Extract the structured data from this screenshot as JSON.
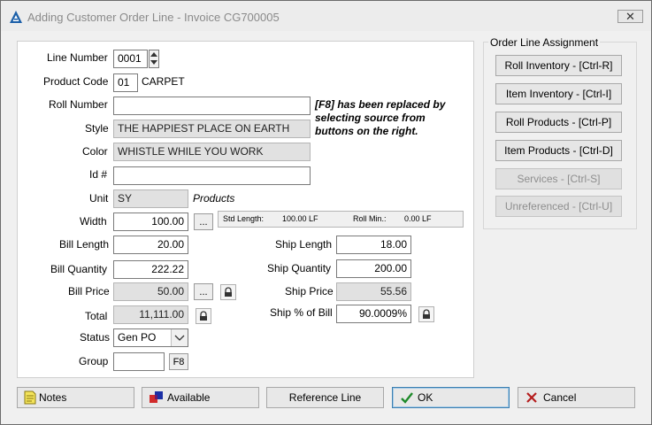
{
  "window": {
    "title": "Adding Customer Order Line - Invoice CG700005",
    "close_glyph": "✕"
  },
  "form": {
    "line_number": {
      "label": "Line Number",
      "value": "0001"
    },
    "product_code": {
      "label": "Product Code",
      "value": "01",
      "description": "CARPET"
    },
    "roll_number": {
      "label": "Roll Number",
      "value": ""
    },
    "note": "[F8] has been replaced by selecting source from buttons on the right.",
    "style": {
      "label": "Style",
      "value": "THE HAPPIEST PLACE ON EARTH"
    },
    "color": {
      "label": "Color",
      "value": "WHISTLE WHILE YOU WORK"
    },
    "id": {
      "label": "Id #",
      "value": ""
    },
    "unit": {
      "label": "Unit",
      "value": "SY",
      "type": "Products"
    },
    "width": {
      "label": "Width",
      "value": "100.00",
      "button": "..."
    },
    "std_length": {
      "label": "Std Length:",
      "value": "100.00 LF"
    },
    "roll_min": {
      "label": "Roll Min.:",
      "value": "0.00 LF"
    },
    "bill_length": {
      "label": "Bill Length",
      "value": "20.00"
    },
    "bill_quantity": {
      "label": "Bill Quantity",
      "value": "222.22"
    },
    "bill_price": {
      "label": "Bill Price",
      "value": "50.00",
      "button": "..."
    },
    "total": {
      "label": "Total",
      "value": "11,111.00"
    },
    "status": {
      "label": "Status",
      "value": "Gen PO"
    },
    "group": {
      "label": "Group",
      "value": "",
      "button": "F8"
    },
    "ship_length": {
      "label": "Ship Length",
      "value": "18.00"
    },
    "ship_quantity": {
      "label": "Ship Quantity",
      "value": "200.00"
    },
    "ship_price": {
      "label": "Ship Price",
      "value": "55.56"
    },
    "ship_pct": {
      "label": "Ship % of Bill",
      "value": "90.0009%"
    }
  },
  "assignment": {
    "title": "Order Line Assignment",
    "roll_inventory": "Roll Inventory - [Ctrl-R]",
    "item_inventory": "Item Inventory - [Ctrl-I]",
    "roll_products": "Roll Products - [Ctrl-P]",
    "item_products": "Item Products - [Ctrl-D]",
    "services": "Services - [Ctrl-S]",
    "unreferenced": "Unreferenced - [Ctrl-U]"
  },
  "footer": {
    "notes": "Notes",
    "available": "Available",
    "reference_line": "Reference Line",
    "ok": "OK",
    "cancel": "Cancel"
  },
  "colors": {
    "accent_blue": "#1b5fa8",
    "ok_check": "#1e8a2a",
    "cancel_x": "#b51d1d",
    "disabled_text": "#8e8e8e"
  }
}
